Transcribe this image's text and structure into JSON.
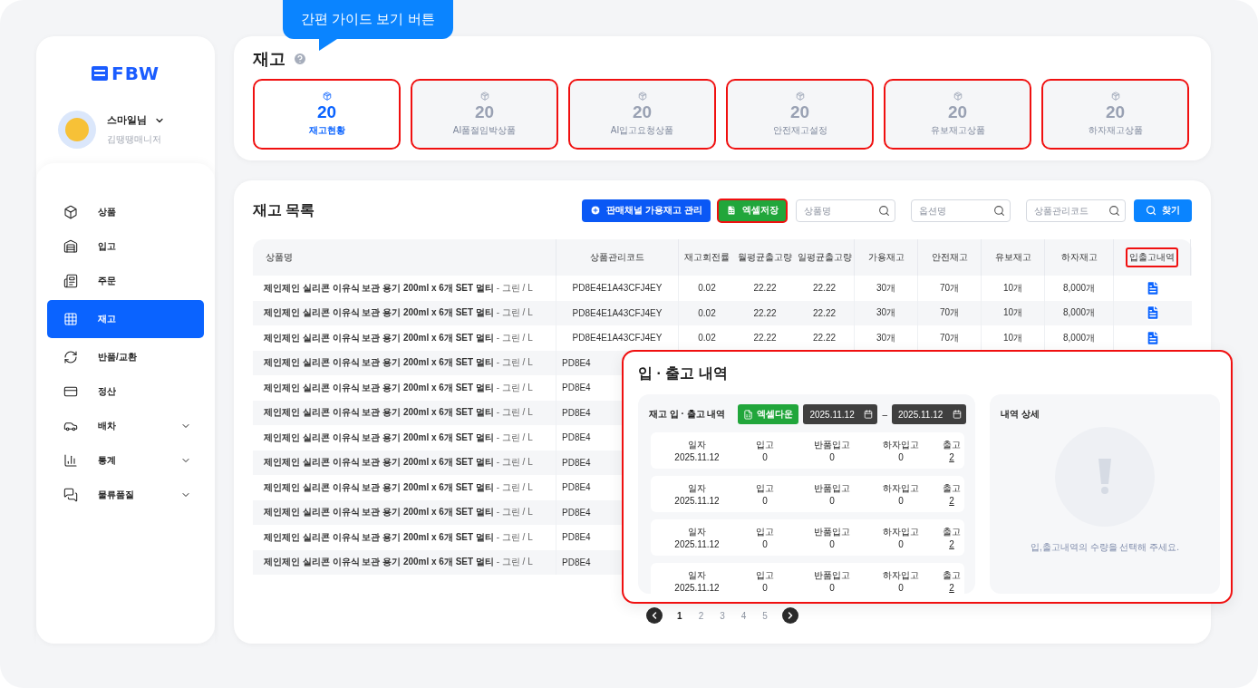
{
  "tooltip": {
    "text": "간편 가이드 보기 버튼"
  },
  "sidebar": {
    "logo": "FBW",
    "user": {
      "name": "스마일님",
      "role": "김땡땡매니저"
    },
    "items": [
      {
        "label": "상품",
        "selected": false,
        "expandable": false
      },
      {
        "label": "입고",
        "selected": false,
        "expandable": false
      },
      {
        "label": "주문",
        "selected": false,
        "expandable": false
      },
      {
        "label": "재고",
        "selected": true,
        "expandable": false
      },
      {
        "label": "반품/교환",
        "selected": false,
        "expandable": false
      },
      {
        "label": "정산",
        "selected": false,
        "expandable": false
      },
      {
        "label": "배차",
        "selected": false,
        "expandable": true
      },
      {
        "label": "통계",
        "selected": false,
        "expandable": true
      },
      {
        "label": "물류품질",
        "selected": false,
        "expandable": true
      }
    ]
  },
  "summary": {
    "title": "재고",
    "cards": [
      {
        "count": "20",
        "label": "재고현황",
        "selected": true
      },
      {
        "count": "20",
        "label": "AI품절임박상품",
        "selected": false
      },
      {
        "count": "20",
        "label": "AI입고요청상품",
        "selected": false
      },
      {
        "count": "20",
        "label": "안전재고설정",
        "selected": false
      },
      {
        "count": "20",
        "label": "유보재고상품",
        "selected": false
      },
      {
        "count": "20",
        "label": "하자재고상품",
        "selected": false
      }
    ]
  },
  "inventory": {
    "title": "재고 목록",
    "toolbar": {
      "channel_button": "판매채널 가용재고 관리",
      "excel_button": "엑셀저장",
      "search_fields": [
        {
          "placeholder": "상품명"
        },
        {
          "placeholder": "옵션명"
        },
        {
          "placeholder": "상품관리코드"
        }
      ],
      "find_button": "찾기"
    },
    "columns": [
      "상품명",
      "상품관리코드",
      "재고회전률",
      "월평균출고량",
      "일평균출고량",
      "가용재고",
      "안전재고",
      "유보재고",
      "하자재고",
      "입출고내역"
    ],
    "rows": [
      {
        "kind": "full",
        "name": "제인제인 실리콘 이유식 보관 용기 200ml x 6개 SET 멀티",
        "option": " - 그린 / L",
        "code": "PD8E4E1A43CFJ4EY",
        "turnover": "0.02",
        "monthly": "22.22",
        "daily": "22.22",
        "available": "30개",
        "safety": "70개",
        "reserved": "10개",
        "defective": "8,000개"
      },
      {
        "kind": "full",
        "name": "제인제인 실리콘 이유식 보관 용기 200ml x 6개 SET 멀티",
        "option": " - 그린 / L",
        "code": "PD8E4E1A43CFJ4EY",
        "turnover": "0.02",
        "monthly": "22.22",
        "daily": "22.22",
        "available": "30개",
        "safety": "70개",
        "reserved": "10개",
        "defective": "8,000개"
      },
      {
        "kind": "full",
        "name": "제인제인 실리콘 이유식 보관 용기 200ml x 6개 SET 멀티",
        "option": " - 그린 / L",
        "code": "PD8E4E1A43CFJ4EY",
        "turnover": "0.02",
        "monthly": "22.22",
        "daily": "22.22",
        "available": "30개",
        "safety": "70개",
        "reserved": "10개",
        "defective": "8,000개"
      },
      {
        "kind": "covered",
        "name": "제인제인 실리콘 이유식 보관 용기 200ml x 6개 SET 멀티",
        "option": " - 그린 / L",
        "code": "PD8E4"
      },
      {
        "kind": "covered",
        "name": "제인제인 실리콘 이유식 보관 용기 200ml x 6개 SET 멀티",
        "option": " - 그린 / L",
        "code": "PD8E4"
      },
      {
        "kind": "covered",
        "name": "제인제인 실리콘 이유식 보관 용기 200ml x 6개 SET 멀티",
        "option": " - 그린 / L",
        "code": "PD8E4"
      },
      {
        "kind": "covered",
        "name": "제인제인 실리콘 이유식 보관 용기 200ml x 6개 SET 멀티",
        "option": " - 그린 / L",
        "code": "PD8E4"
      },
      {
        "kind": "covered",
        "name": "제인제인 실리콘 이유식 보관 용기 200ml x 6개 SET 멀티",
        "option": " - 그린 / L",
        "code": "PD8E4"
      },
      {
        "kind": "covered",
        "name": "제인제인 실리콘 이유식 보관 용기 200ml x 6개 SET 멀티",
        "option": " - 그린 / L",
        "code": "PD8E4"
      },
      {
        "kind": "covered",
        "name": "제인제인 실리콘 이유식 보관 용기 200ml x 6개 SET 멀티",
        "option": " - 그린 / L",
        "code": "PD8E4"
      },
      {
        "kind": "covered",
        "name": "제인제인 실리콘 이유식 보관 용기 200ml x 6개 SET 멀티",
        "option": " - 그린 / L",
        "code": "PD8E4"
      },
      {
        "kind": "covered",
        "name": "제인제인 실리콘 이유식 보관 용기 200ml x 6개 SET 멀티",
        "option": " - 그린 / L",
        "code": "PD8E4"
      }
    ],
    "pagination": [
      {
        "label": "1",
        "selected": true
      },
      {
        "label": "2",
        "selected": false
      },
      {
        "label": "3",
        "selected": false
      },
      {
        "label": "4",
        "selected": false
      },
      {
        "label": "5",
        "selected": false
      }
    ]
  },
  "history_modal": {
    "title": "입 · 출고 내역",
    "list": {
      "title": "재고 입 · 출고 내역",
      "excel_button": "엑셀다운",
      "date_from": "2025.11.12",
      "date_separator": "–",
      "date_to": "2025.11.12",
      "records": [
        {
          "date_label": "일자",
          "date": "2025.11.12",
          "in_label": "입고",
          "in": "0",
          "return_label": "반품입고",
          "return": "0",
          "defect_label": "하자입고",
          "defect": "0",
          "out_label": "출고",
          "out": "2"
        },
        {
          "date_label": "일자",
          "date": "2025.11.12",
          "in_label": "입고",
          "in": "0",
          "return_label": "반품입고",
          "return": "0",
          "defect_label": "하자입고",
          "defect": "0",
          "out_label": "출고",
          "out": "2"
        },
        {
          "date_label": "일자",
          "date": "2025.11.12",
          "in_label": "입고",
          "in": "0",
          "return_label": "반품입고",
          "return": "0",
          "defect_label": "하자입고",
          "defect": "0",
          "out_label": "출고",
          "out": "2"
        },
        {
          "date_label": "일자",
          "date": "2025.11.12",
          "in_label": "입고",
          "in": "0",
          "return_label": "반품입고",
          "return": "0",
          "defect_label": "하자입고",
          "defect": "0",
          "out_label": "출고",
          "out": "2"
        }
      ]
    },
    "detail": {
      "title": "내역 상세",
      "message": "입,출고내역의 수량을 선택해 주세요."
    }
  }
}
